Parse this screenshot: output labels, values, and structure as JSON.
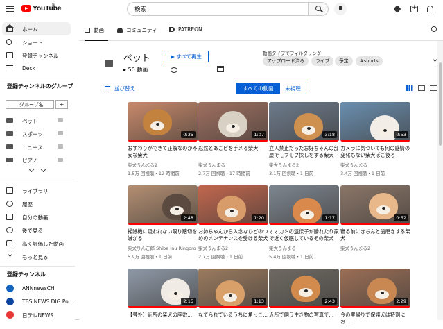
{
  "header": {
    "logo_text": "YouTube",
    "logo_region": "JP",
    "search_value": "検索"
  },
  "sidebar": {
    "nav": [
      {
        "label": "ホーム",
        "icon": "home-icon",
        "active": true
      },
      {
        "label": "ショート",
        "icon": "shorts-icon"
      },
      {
        "label": "登録チャンネル",
        "icon": "subscriptions-icon"
      },
      {
        "label": "Deck",
        "icon": "deck-icon"
      }
    ],
    "groups_heading": "登録チャンネルのグループ",
    "group_input_placeholder": "グループ名",
    "group_add": "+",
    "groups": [
      {
        "label": "ペット"
      },
      {
        "label": "スポーツ"
      },
      {
        "label": "ニュース"
      },
      {
        "label": "ピアノ"
      }
    ],
    "library": [
      {
        "label": "ライブラリ",
        "icon": "library-icon"
      },
      {
        "label": "履歴",
        "icon": "history-icon"
      },
      {
        "label": "自分の動画",
        "icon": "your-videos-icon"
      },
      {
        "label": "後で見る",
        "icon": "watch-later-icon"
      },
      {
        "label": "高く評価した動画",
        "icon": "liked-icon"
      },
      {
        "label": "もっと見る",
        "icon": "chevron-down-icon"
      }
    ],
    "subs_heading": "登録チャンネル",
    "subscriptions": [
      {
        "label": "ANNnewsCH",
        "color": "#1565c0"
      },
      {
        "label": "TBS NEWS DIG Po...",
        "color": "#0d47a1"
      },
      {
        "label": "日テレNEWS",
        "color": "#e53935"
      }
    ]
  },
  "tabs": [
    {
      "label": "動画",
      "active": true
    },
    {
      "label": "コミュニティ"
    },
    {
      "label": "PATREON"
    }
  ],
  "playlist": {
    "title": "ペット",
    "count": "50 動画",
    "play_all": "すべて再生",
    "filter_label": "動画タイプでフィルタリング",
    "chips": [
      "アップロード済み",
      "ライブ",
      "予定",
      "#shorts"
    ],
    "sort": "並び替え",
    "seg_all": "すべての動画",
    "seg_unwatched": "未視聴"
  },
  "videos": [
    {
      "title": "おすわりができて正解なのか不安な柴犬",
      "channel": "柴犬うんまる2",
      "meta": "1.5万 回視聴・12 時間前",
      "duration": "0:35",
      "bg": "#c98a6b",
      "dog": "#c4823f"
    },
    {
      "title": "忍然とあごピを手メる柴犬",
      "channel": "柴犬うんまる",
      "meta": "2.7万 回視聴・17 時間前",
      "duration": "1:07",
      "bg": "#a07060",
      "dog": "#d9d0c4"
    },
    {
      "title": "立入禁止だったお好ちゃんの部屋でモフモフ探しをする柴犬",
      "channel": "柴犬うんまる2",
      "meta": "3.1万 回視聴・1 日前",
      "duration": "3:18",
      "bg": "#6d7b8c",
      "dog": "#cf9150"
    },
    {
      "title": "カメラに気づいても何の感情の変化もない柴犬ぽこ後ろ",
      "channel": "柴犬うんまる",
      "meta": "3.4万 回視聴・1 日前",
      "duration": "0:53",
      "bg": "#6a8fb0",
      "dog": "#f2ede6"
    },
    {
      "title": "掃除機に吸われない限り踏切を嫌がる",
      "channel": "柴犬りんご郎 Shiba Inu Ringoro",
      "meta": "5.9万 回視聴・1 日前",
      "duration": "2:48",
      "bg": "#b48f72",
      "dog": "#5b4a40"
    },
    {
      "title": "お姉ちゃんから入念なひどのつめのメンテナンスを受ける柴犬",
      "channel": "柴犬うんまる2",
      "meta": "2.7万 回視聴・1 日前",
      "duration": "1:20",
      "bg": "#c2674e",
      "dog": "#d79c6a"
    },
    {
      "title": "オオカミの遺伝子が勝れたり家で近く仮眠しているその柴犬",
      "channel": "柴犬うんまる",
      "meta": "5.4万 回視聴・1 日前",
      "duration": "1:17",
      "bg": "#7d8690",
      "dog": "#d8894b"
    },
    {
      "title": "寝る前にきちんと歯磨きする柴犬",
      "channel": "柴犬うんまる2",
      "meta": "",
      "duration": "0:52",
      "bg": "#8b7668",
      "dog": "#e8b88a"
    },
    {
      "title": "【号外】近所の柴犬の座敷...",
      "channel": "",
      "meta": "",
      "duration": "2:15",
      "bg": "#8f9aa8",
      "dog": "#f0ebe4"
    },
    {
      "title": "なでられているうちに角っこ...",
      "channel": "",
      "meta": "",
      "duration": "1:13",
      "bg": "#9b7b5f",
      "dog": "#d9a06a"
    },
    {
      "title": "近所で飼う生き物の写真で...",
      "channel": "",
      "meta": "",
      "duration": "2:43",
      "bg": "#6f6a63",
      "dog": "#d28b4c"
    },
    {
      "title": "今の里帰りで保護犬は特別にお...",
      "channel": "",
      "meta": "",
      "duration": "2:29",
      "bg": "#9b6f56",
      "dog": "#c98852"
    }
  ]
}
